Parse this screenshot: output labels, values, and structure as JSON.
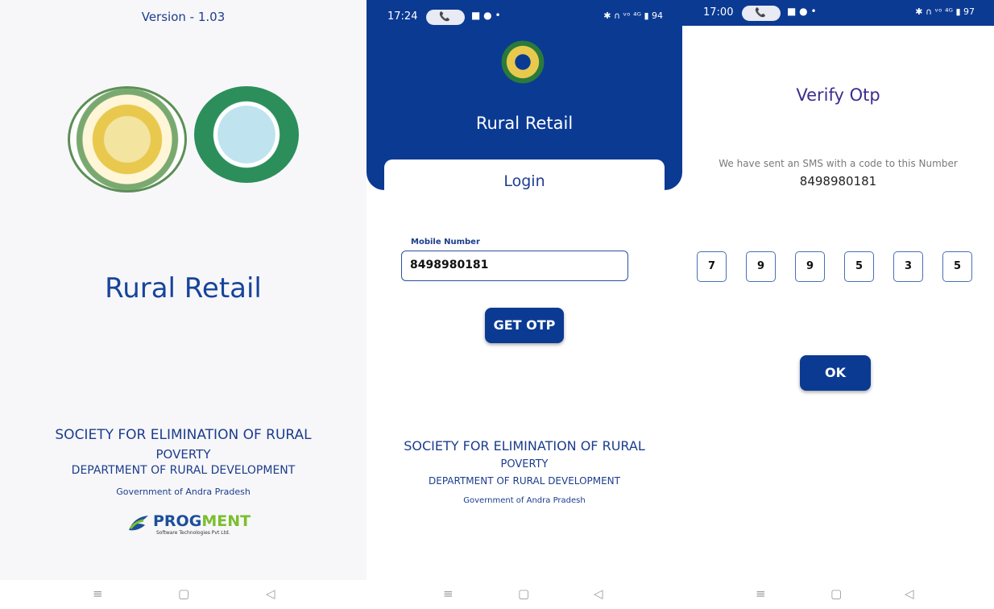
{
  "splash": {
    "version": "Version - 1.03",
    "app_title": "Rural Retail",
    "org_line1": "SOCIETY FOR ELIMINATION OF RURAL",
    "org_line2": "POVERTY",
    "org_line3": "DEPARTMENT OF RURAL DEVELOPMENT",
    "org_line4": "Government of Andra Pradesh",
    "logo_word_a": "PROG",
    "logo_word_b": "MENT",
    "logo_tagline": "Software Technologies Pvt Ltd."
  },
  "login": {
    "status_time": "17:24",
    "status_right": "✱ ∩ ᵛᵒ ⁴ᴳ ▮ 94",
    "app_title": "Rural Retail",
    "card_title": "Login",
    "field_label": "Mobile Number",
    "mobile_value": "8498980181",
    "otp_button": "GET OTP",
    "org_line1": "SOCIETY FOR ELIMINATION OF RURAL",
    "org_line2": "POVERTY",
    "org_line3": "DEPARTMENT OF RURAL DEVELOPMENT",
    "org_line4": "Government of Andra Pradesh"
  },
  "verify": {
    "status_time": "17:00",
    "status_right": "✱ ∩ ᵛᵒ ⁴ᴳ ▮ 97",
    "title": "Verify Otp",
    "sms_text": "We have sent an SMS with a code to this Number",
    "phone_number": "8498980181",
    "otp_digits": [
      "7",
      "9",
      "9",
      "5",
      "3",
      "5"
    ],
    "ok_button": "OK"
  },
  "navbar": {
    "menu_glyph": "≡",
    "home_glyph": "▢",
    "back_glyph": "◁"
  },
  "colors": {
    "brand_blue": "#0b3a93",
    "text_blue": "#1c3d8c",
    "logo_green": "#7bbf2f"
  }
}
